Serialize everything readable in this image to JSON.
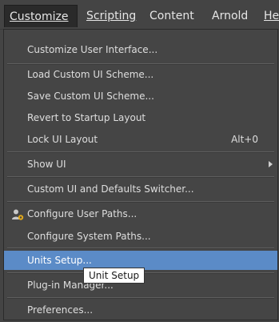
{
  "menubar": {
    "items": [
      {
        "label": "Customize",
        "underline": "C",
        "active": true
      },
      {
        "label": "Scripting",
        "underline": "S"
      },
      {
        "label": "Content"
      },
      {
        "label": "Arnold"
      },
      {
        "label": "He",
        "underline": "H"
      }
    ]
  },
  "menu": {
    "items": [
      {
        "label": "Customize User Interface..."
      },
      {
        "label": "Load Custom UI Scheme..."
      },
      {
        "label": "Save Custom UI Scheme..."
      },
      {
        "label": "Revert to Startup Layout"
      },
      {
        "label": "Lock UI Layout",
        "shortcut": "Alt+0"
      },
      {
        "label": "Show UI"
      },
      {
        "label": "Custom UI and Defaults Switcher..."
      },
      {
        "label": "Configure User Paths...",
        "icon": "user-gear-icon"
      },
      {
        "label": "Configure System Paths..."
      },
      {
        "label": "Units Setup...",
        "highlighted": true
      },
      {
        "label": "Plug-in Manager..."
      },
      {
        "label": "Preferences..."
      }
    ]
  },
  "tooltip": {
    "text": "Unit Setup"
  },
  "colors": {
    "highlight": "#5b8bc7",
    "menu_bg": "#454545",
    "bar_bg": "#444444"
  }
}
